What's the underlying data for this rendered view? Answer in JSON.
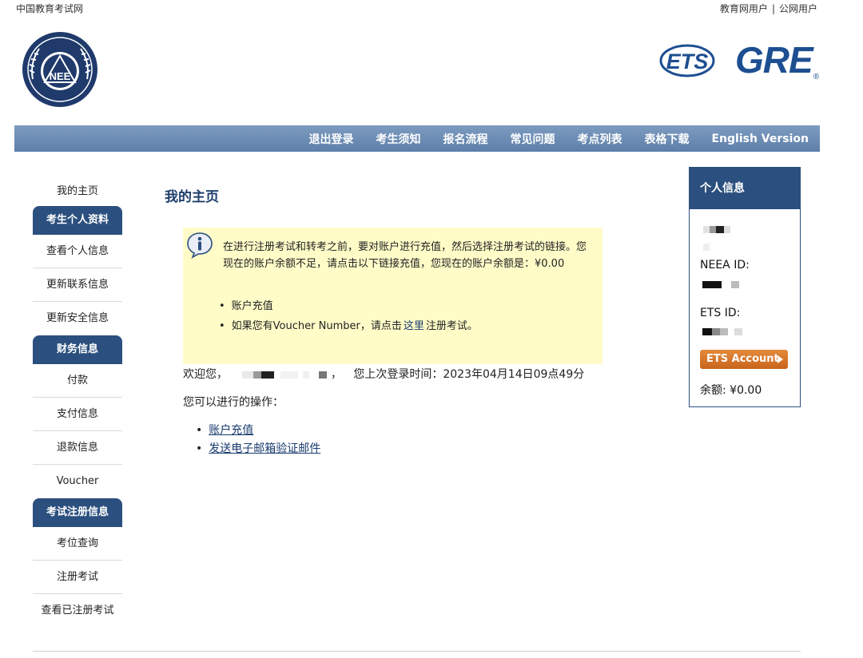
{
  "top": {
    "site_name": "中国教育考试网",
    "edu_user": "教育网用户",
    "separator": "|",
    "public_user": "公网用户"
  },
  "logos": {
    "neea_text": "NEE",
    "ets_text": "ETS",
    "gre_text": "GRE",
    "gre_mark": "®"
  },
  "nav": {
    "items": [
      "退出登录",
      "考生须知",
      "报名流程",
      "常见问题",
      "考点列表",
      "表格下载",
      "English Version"
    ]
  },
  "sidebar": {
    "home": "我的主页",
    "section_profile": "考生个人资料",
    "view_info": "查看个人信息",
    "update_contact": "更新联系信息",
    "update_security": "更新安全信息",
    "section_finance": "财务信息",
    "payment": "付款",
    "payment_info": "支付信息",
    "refund_info": "退款信息",
    "voucher": "Voucher",
    "section_exam": "考试注册信息",
    "seat_query": "考位查询",
    "register_exam": "注册考试",
    "view_registered": "查看已注册考试"
  },
  "main": {
    "title": "我的主页",
    "notice_text": "在进行注册考试和转考之前，要对账户进行充值，然后选择注册考试的链接。您现在的账户余额不足，请点击以下链接充值，您现在的账户余额是：¥0.00",
    "notice_item1": "账户充值",
    "notice_item2_pre": "如果您有Voucher Number，请点击",
    "notice_item2_link": "这里",
    "notice_item2_post": "注册考试。",
    "welcome_pre": "欢迎您，",
    "welcome_comma": "，",
    "last_login": "您上次登录时间：2023年04月14日09点49分",
    "ops_label": "您可以进行的操作：",
    "ops": [
      "账户充值",
      "发送电子邮箱验证邮件"
    ]
  },
  "infobox": {
    "title": "个人信息",
    "neea_label": "NEEA ID:",
    "ets_label": "ETS ID:",
    "ets_button": "ETS Account",
    "balance": "余额: ¥0.00"
  },
  "colors": {
    "nav_bar": "#6b8bb5",
    "section_head": "#2b4f7e",
    "notice_bg": "#fffcc8",
    "brand_blue": "#1d4f91",
    "ets_button": "#d4762a"
  }
}
